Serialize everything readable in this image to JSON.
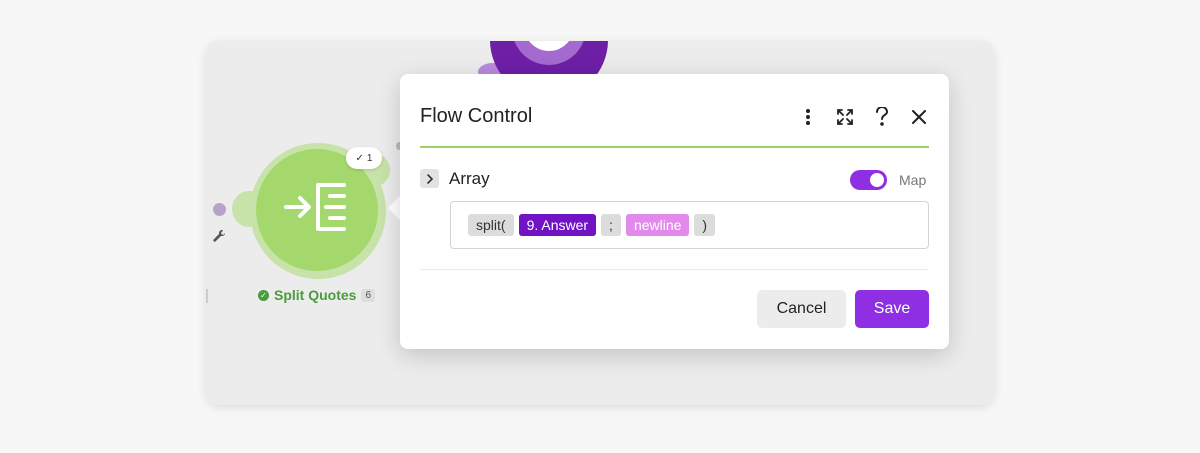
{
  "dialog": {
    "title": "Flow Control",
    "toolbar": {
      "more_icon": "more-vertical-icon",
      "expand_icon": "expand-icon",
      "help_icon": "help-icon",
      "close_icon": "close-icon"
    },
    "field": {
      "label": "Array",
      "map_label": "Map",
      "map_enabled": true
    },
    "formula": {
      "tokens": [
        {
          "text": "split(",
          "kind": "function"
        },
        {
          "text": "9. Answer",
          "kind": "variable"
        },
        {
          "text": ";",
          "kind": "separator"
        },
        {
          "text": "newline",
          "kind": "keyword"
        },
        {
          "text": ")",
          "kind": "function"
        }
      ]
    },
    "buttons": {
      "cancel": "Cancel",
      "save": "Save"
    }
  },
  "module": {
    "name": "Split Quotes",
    "count": "6",
    "badge": "1"
  },
  "colors": {
    "accent": "#8e2fe3",
    "variable_pill": "#7112c4",
    "keyword_pill": "#e28aeb",
    "module_green": "#a4d86d",
    "title_rule": "#9ad36a"
  }
}
